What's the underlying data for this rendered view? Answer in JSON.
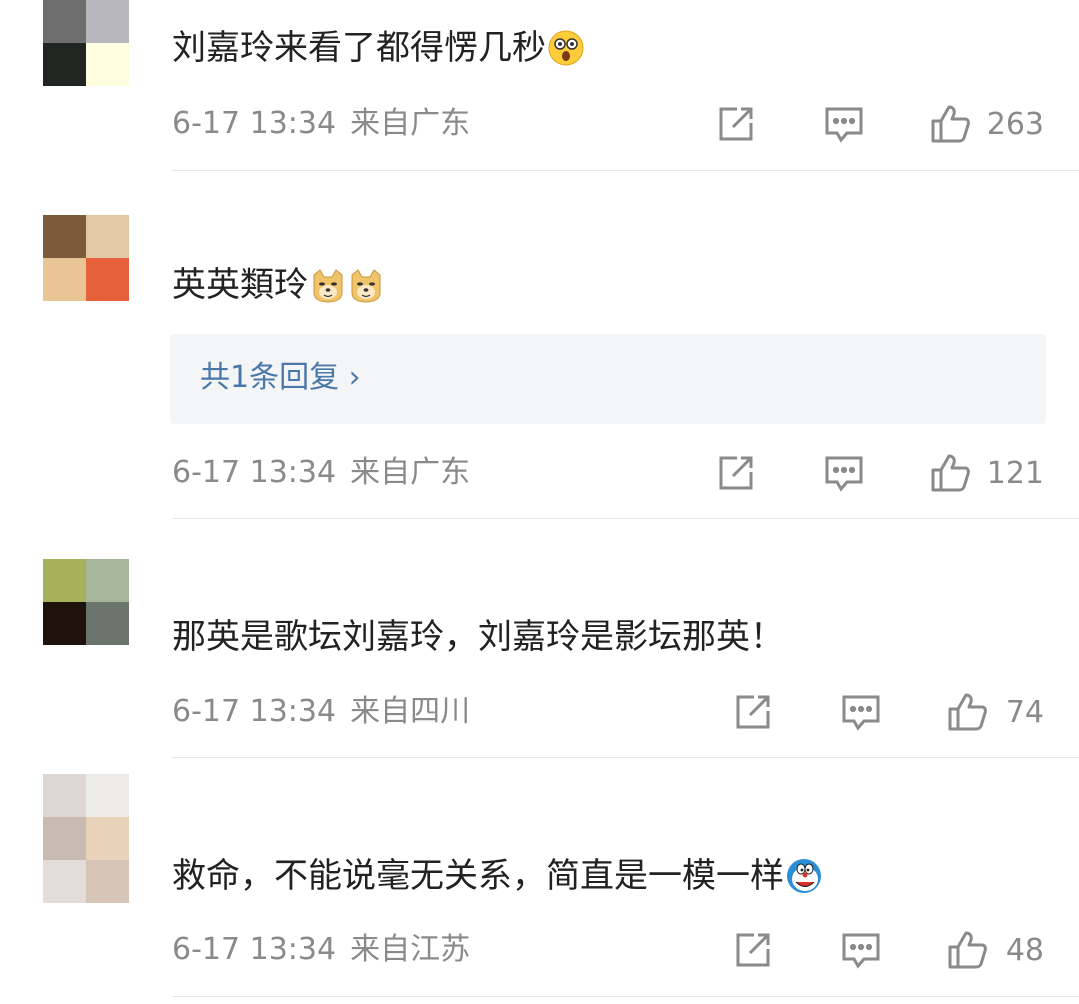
{
  "comments": [
    {
      "text": "刘嘉玲来看了都得愣几秒",
      "emoji": "astonished-emoji",
      "date": "6-17 13:34",
      "location": "来自广东",
      "likes": "263",
      "avatar_colors": [
        "#6e6e6e",
        "#b8b8bc",
        "#222623",
        "#fffde0"
      ]
    },
    {
      "text": "英英類玲",
      "emoji": "doge-emoji",
      "reply_summary": "共1条回复 ›",
      "date": "6-17 13:34",
      "location": "来自广东",
      "likes": "121",
      "avatar_colors": [
        "#7d5a3a",
        "#e3c9a3",
        "#e9c596",
        "#e6603c"
      ]
    },
    {
      "text": "那英是歌坛刘嘉玲，刘嘉玲是影坛那英！",
      "date": "6-17 13:34",
      "location": "来自四川",
      "likes": "74",
      "avatar_colors": [
        "#a6b25a",
        "#a7b59a",
        "#1e120c",
        "#6b756c"
      ]
    },
    {
      "text": "救命，不能说毫无关系，简直是一模一样",
      "emoji": "doraemon-emoji",
      "date": "6-17 13:34",
      "location": "来自江苏",
      "likes": "48",
      "avatar_colors": [
        "#dcd7d3",
        "#eceae7",
        "#c8bcb2",
        "#e8d3b8",
        "#e4dcd8",
        "#d6c5b6"
      ]
    }
  ],
  "icons": {
    "share": "share-icon",
    "reply": "comment-icon",
    "like": "thumbs-up-icon"
  },
  "colors": {
    "text": "#222222",
    "meta": "#8a8a8a",
    "link": "#4a78a8",
    "reply_bg": "#f4f5f7"
  }
}
